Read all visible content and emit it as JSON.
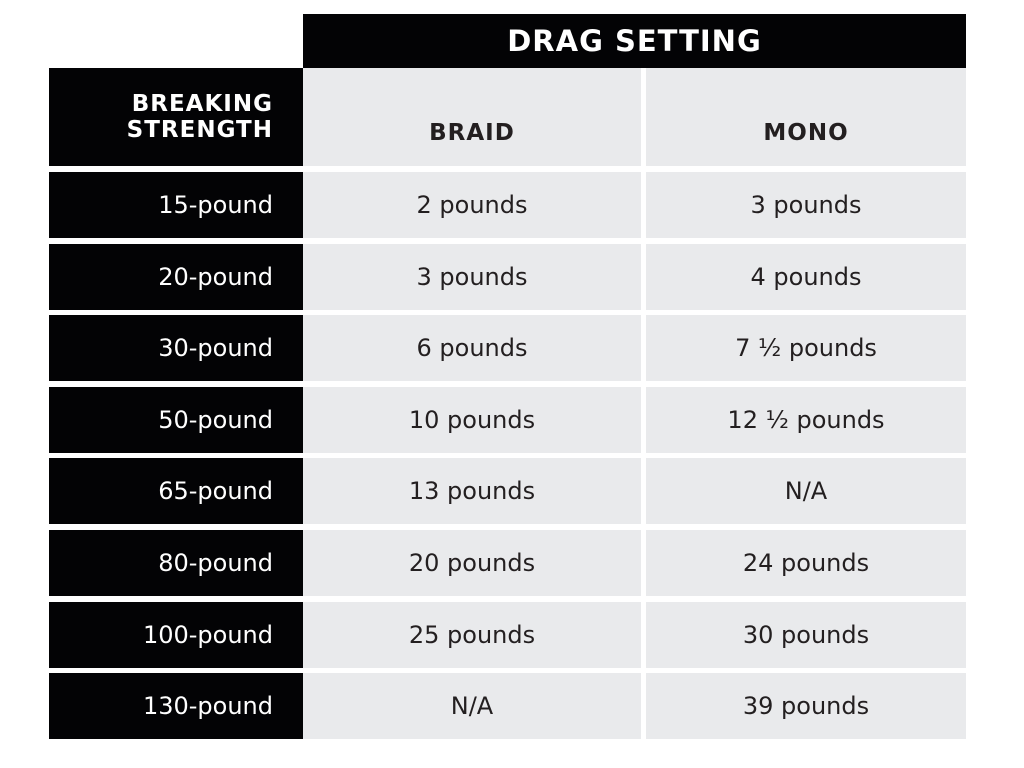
{
  "table": {
    "group_header": "DRAG SETTING",
    "row_header": "BREAKING STRENGTH",
    "row_header_lines": [
      "BREAKING",
      "STRENGTH"
    ],
    "columns": [
      "BRAID",
      "MONO"
    ],
    "rows": [
      {
        "strength": "15-pound",
        "braid": "2 pounds",
        "mono": "3 pounds"
      },
      {
        "strength": "20-pound",
        "braid": "3 pounds",
        "mono": "4 pounds"
      },
      {
        "strength": "30-pound",
        "braid": "6 pounds",
        "mono": "7 ½ pounds"
      },
      {
        "strength": "50-pound",
        "braid": "10 pounds",
        "mono": "12 ½ pounds"
      },
      {
        "strength": "65-pound",
        "braid": "13 pounds",
        "mono": "N/A"
      },
      {
        "strength": "80-pound",
        "braid": "20 pounds",
        "mono": "24 pounds"
      },
      {
        "strength": "100-pound",
        "braid": "25 pounds",
        "mono": "30 pounds"
      },
      {
        "strength": "130-pound",
        "braid": "N/A",
        "mono": "39 pounds"
      }
    ]
  },
  "colors": {
    "header_bg": "#030305",
    "cell_bg": "#e9eaec",
    "cell_text": "#231f20",
    "header_text": "#ffffff"
  }
}
